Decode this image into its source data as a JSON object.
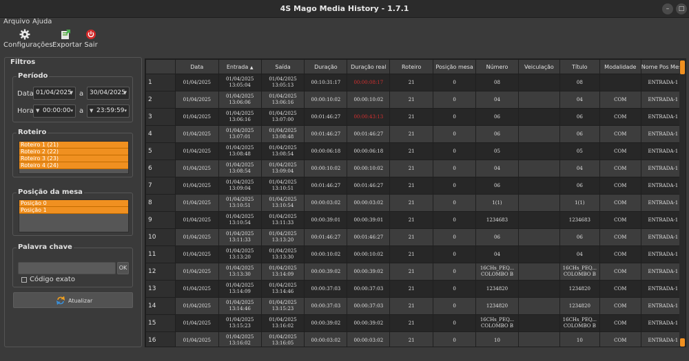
{
  "window": {
    "title": "4S Mago Media History - 1.7.1"
  },
  "menu": {
    "items": [
      "Arquivo",
      "Ajuda"
    ]
  },
  "toolbar": {
    "settings": "Configurações",
    "export": "Exportar",
    "exit": "Sair"
  },
  "filters": {
    "title": "Filtros",
    "period": {
      "title": "Período",
      "date_label": "Data",
      "date_from": "01/04/2025",
      "date_to": "30/04/2025",
      "time_label": "Hora",
      "time_from": "00:00:00",
      "time_to": "23:59:59",
      "to_label": "a"
    },
    "route": {
      "title": "Roteiro",
      "items": [
        "Roteiro 1 (21)",
        "Roteiro 2 (22)",
        "Roteiro 3 (23)",
        "Roteiro 4 (24)"
      ]
    },
    "table_position": {
      "title": "Posição da mesa",
      "items": [
        "Posição 0",
        "Posição 1"
      ]
    },
    "keyword": {
      "title": "Palavra chave",
      "value": "",
      "ok": "OK",
      "exact_label": "Código exato",
      "exact_checked": false
    },
    "refresh_label": "Atualizar"
  },
  "table": {
    "columns": [
      "Data",
      "Entrada",
      "Saída",
      "Duração",
      "Duração real",
      "Roteiro",
      "Posição mesa",
      "Número",
      "Veiculação",
      "Título",
      "Modalidade",
      "Nome Pos Mesa"
    ],
    "sort_column": "Entrada",
    "rows": [
      {
        "n": "1",
        "data": "01/04/2025",
        "entrada": "01/04/2025\n13:05:04",
        "saida": "01/04/2025\n13:05:13",
        "duracao": "00:10:31:17",
        "real": "00:00:08:17",
        "real_red": true,
        "roteiro": "21",
        "posicao": "0",
        "numero": "08",
        "veiculacao": "",
        "titulo": "08",
        "modalidade": "",
        "nome": "ENTRADA-1"
      },
      {
        "n": "2",
        "data": "01/04/2025",
        "entrada": "01/04/2025\n13:06:06",
        "saida": "01/04/2025\n13:06:16",
        "duracao": "00:00:10:02",
        "real": "00:00:10:02",
        "real_red": false,
        "roteiro": "21",
        "posicao": "0",
        "numero": "04",
        "veiculacao": "",
        "titulo": "04",
        "modalidade": "COM",
        "nome": "ENTRADA-1"
      },
      {
        "n": "3",
        "data": "01/04/2025",
        "entrada": "01/04/2025\n13:06:16",
        "saida": "01/04/2025\n13:07:00",
        "duracao": "00:01:46:27",
        "real": "00:00:43:13",
        "real_red": true,
        "roteiro": "21",
        "posicao": "0",
        "numero": "06",
        "veiculacao": "",
        "titulo": "06",
        "modalidade": "COM",
        "nome": "ENTRADA-1"
      },
      {
        "n": "4",
        "data": "01/04/2025",
        "entrada": "01/04/2025\n13:07:01",
        "saida": "01/04/2025\n13:08:48",
        "duracao": "00:01:46:27",
        "real": "00:01:46:27",
        "real_red": false,
        "roteiro": "21",
        "posicao": "0",
        "numero": "06",
        "veiculacao": "",
        "titulo": "06",
        "modalidade": "COM",
        "nome": "ENTRADA-1"
      },
      {
        "n": "5",
        "data": "01/04/2025",
        "entrada": "01/04/2025\n13:08:48",
        "saida": "01/04/2025\n13:08:54",
        "duracao": "00:00:06:18",
        "real": "00:00:06:18",
        "real_red": false,
        "roteiro": "21",
        "posicao": "0",
        "numero": "05",
        "veiculacao": "",
        "titulo": "05",
        "modalidade": "COM",
        "nome": "ENTRADA-1"
      },
      {
        "n": "6",
        "data": "01/04/2025",
        "entrada": "01/04/2025\n13:08:54",
        "saida": "01/04/2025\n13:09:04",
        "duracao": "00:00:10:02",
        "real": "00:00:10:02",
        "real_red": false,
        "roteiro": "21",
        "posicao": "0",
        "numero": "04",
        "veiculacao": "",
        "titulo": "04",
        "modalidade": "COM",
        "nome": "ENTRADA-1"
      },
      {
        "n": "7",
        "data": "01/04/2025",
        "entrada": "01/04/2025\n13:09:04",
        "saida": "01/04/2025\n13:10:51",
        "duracao": "00:01:46:27",
        "real": "00:01:46:27",
        "real_red": false,
        "roteiro": "21",
        "posicao": "0",
        "numero": "06",
        "veiculacao": "",
        "titulo": "06",
        "modalidade": "COM",
        "nome": "ENTRADA-1"
      },
      {
        "n": "8",
        "data": "01/04/2025",
        "entrada": "01/04/2025\n13:10:51",
        "saida": "01/04/2025\n13:10:54",
        "duracao": "00:00:03:02",
        "real": "00:00:03:02",
        "real_red": false,
        "roteiro": "21",
        "posicao": "0",
        "numero": "1(1)",
        "veiculacao": "",
        "titulo": "1(1)",
        "modalidade": "COM",
        "nome": "ENTRADA-1"
      },
      {
        "n": "9",
        "data": "01/04/2025",
        "entrada": "01/04/2025\n13:10:54",
        "saida": "01/04/2025\n13:11:33",
        "duracao": "00:00:39:01",
        "real": "00:00:39:01",
        "real_red": false,
        "roteiro": "21",
        "posicao": "0",
        "numero": "1234683",
        "veiculacao": "",
        "titulo": "1234683",
        "modalidade": "COM",
        "nome": "ENTRADA-1"
      },
      {
        "n": "10",
        "data": "01/04/2025",
        "entrada": "01/04/2025\n13:11:33",
        "saida": "01/04/2025\n13:13:20",
        "duracao": "00:01:46:27",
        "real": "00:01:46:27",
        "real_red": false,
        "roteiro": "21",
        "posicao": "0",
        "numero": "06",
        "veiculacao": "",
        "titulo": "06",
        "modalidade": "COM",
        "nome": "ENTRADA-1"
      },
      {
        "n": "11",
        "data": "01/04/2025",
        "entrada": "01/04/2025\n13:13:20",
        "saida": "01/04/2025\n13:13:30",
        "duracao": "00:00:10:02",
        "real": "00:00:10:02",
        "real_red": false,
        "roteiro": "21",
        "posicao": "0",
        "numero": "04",
        "veiculacao": "",
        "titulo": "04",
        "modalidade": "COM",
        "nome": "ENTRADA-1"
      },
      {
        "n": "12",
        "data": "01/04/2025",
        "entrada": "01/04/2025\n13:13:30",
        "saida": "01/04/2025\n13:14:09",
        "duracao": "00:00:39:02",
        "real": "00:00:39:02",
        "real_red": false,
        "roteiro": "21",
        "posicao": "0",
        "numero": "16CHs_PEQ...\nCOLOMBO B",
        "veiculacao": "",
        "titulo": "16CHs_PEQ...\nCOLOMBO B",
        "modalidade": "COM",
        "nome": "ENTRADA-1"
      },
      {
        "n": "13",
        "data": "01/04/2025",
        "entrada": "01/04/2025\n13:14:09",
        "saida": "01/04/2025\n13:14:46",
        "duracao": "00:00:37:03",
        "real": "00:00:37:03",
        "real_red": false,
        "roteiro": "21",
        "posicao": "0",
        "numero": "1234820",
        "veiculacao": "",
        "titulo": "1234820",
        "modalidade": "COM",
        "nome": "ENTRADA-1"
      },
      {
        "n": "14",
        "data": "01/04/2025",
        "entrada": "01/04/2025\n13:14:46",
        "saida": "01/04/2025\n13:15:23",
        "duracao": "00:00:37:03",
        "real": "00:00:37:03",
        "real_red": false,
        "roteiro": "21",
        "posicao": "0",
        "numero": "1234820",
        "veiculacao": "",
        "titulo": "1234820",
        "modalidade": "COM",
        "nome": "ENTRADA-1"
      },
      {
        "n": "15",
        "data": "01/04/2025",
        "entrada": "01/04/2025\n13:15:23",
        "saida": "01/04/2025\n13:16:02",
        "duracao": "00:00:39:02",
        "real": "00:00:39:02",
        "real_red": false,
        "roteiro": "21",
        "posicao": "0",
        "numero": "16CHs_PEQ...\nCOLOMBO B",
        "veiculacao": "",
        "titulo": "16CHs_PEQ...\nCOLOMBO B",
        "modalidade": "COM",
        "nome": "ENTRADA-1"
      },
      {
        "n": "16",
        "data": "01/04/2025",
        "entrada": "01/04/2025\n13:16:02",
        "saida": "01/04/2025\n13:16:05",
        "duracao": "00:00:03:02",
        "real": "00:00:03:02",
        "real_red": false,
        "roteiro": "21",
        "posicao": "0",
        "numero": "10",
        "veiculacao": "",
        "titulo": "10",
        "modalidade": "COM",
        "nome": "ENTRADA-1"
      }
    ]
  },
  "colors": {
    "accent": "#f09020",
    "alert": "#d33030",
    "background": "#3a3a3a"
  }
}
